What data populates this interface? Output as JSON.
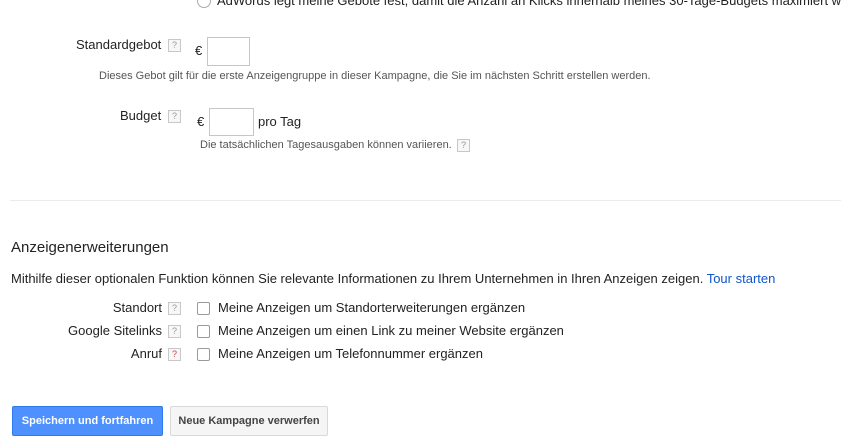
{
  "bidding_option": {
    "label": "AdWords legt meine Gebote fest, damit die Anzahl an Klicks innerhalb meines 30-Tage-Budgets maximiert w"
  },
  "standard_bid": {
    "label": "Standardgebot",
    "help": "?",
    "currency": "€",
    "value": "",
    "hint": "Dieses Gebot gilt für die erste Anzeigengruppe in dieser Kampagne, die Sie im nächsten Schritt erstellen werden."
  },
  "budget": {
    "label": "Budget",
    "help": "?",
    "currency": "€",
    "value": "",
    "unit": "pro Tag",
    "hint": "Die tatsächlichen Tagesausgaben können variieren.",
    "hint_help": "?"
  },
  "extensions": {
    "title": "Anzeigenerweiterungen",
    "description": "Mithilfe dieser optionalen Funktion können Sie relevante Informationen zu Ihrem Unternehmen in Ihren Anzeigen zeigen.",
    "tour_link": "Tour starten",
    "items": [
      {
        "label": "Standort",
        "help": "?",
        "checkbox_label": "Meine Anzeigen um Standorterweiterungen ergänzen",
        "checked": false
      },
      {
        "label": "Google Sitelinks",
        "help": "?",
        "checkbox_label": "Meine Anzeigen um einen Link zu meiner Website ergänzen",
        "checked": false
      },
      {
        "label": "Anruf",
        "help": "?",
        "checkbox_label": "Meine Anzeigen um Telefonnummer ergänzen",
        "checked": false
      }
    ]
  },
  "actions": {
    "save": "Speichern und fortfahren",
    "discard": "Neue Kampagne verwerfen"
  },
  "colors": {
    "primary_button": "#4d90fe",
    "link": "#1155cc"
  }
}
